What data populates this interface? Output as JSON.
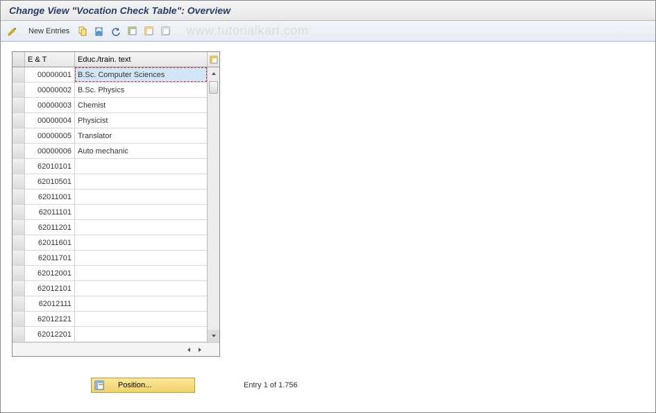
{
  "title": "Change View \"Vocation Check Table\": Overview",
  "toolbar": {
    "new_entries_label": "New Entries"
  },
  "watermark": "www.tutorialkart.com",
  "table": {
    "col1_header": "E & T",
    "col2_header": "Educ./train. text",
    "rows": [
      {
        "id": "00000001",
        "text": "B.Sc. Computer Sciences"
      },
      {
        "id": "00000002",
        "text": "B.Sc. Physics"
      },
      {
        "id": "00000003",
        "text": "Chemist"
      },
      {
        "id": "00000004",
        "text": "Physicist"
      },
      {
        "id": "00000005",
        "text": "Translator"
      },
      {
        "id": "00000006",
        "text": "Auto mechanic"
      },
      {
        "id": "62010101",
        "text": ""
      },
      {
        "id": "62010501",
        "text": ""
      },
      {
        "id": "62011001",
        "text": ""
      },
      {
        "id": "62011101",
        "text": ""
      },
      {
        "id": "62011201",
        "text": ""
      },
      {
        "id": "62011601",
        "text": ""
      },
      {
        "id": "62011701",
        "text": ""
      },
      {
        "id": "62012001",
        "text": ""
      },
      {
        "id": "62012101",
        "text": ""
      },
      {
        "id": "62012111",
        "text": ""
      },
      {
        "id": "62012121",
        "text": ""
      },
      {
        "id": "62012201",
        "text": ""
      }
    ]
  },
  "footer": {
    "position_label": "Position...",
    "entry_text": "Entry 1 of 1.756"
  }
}
